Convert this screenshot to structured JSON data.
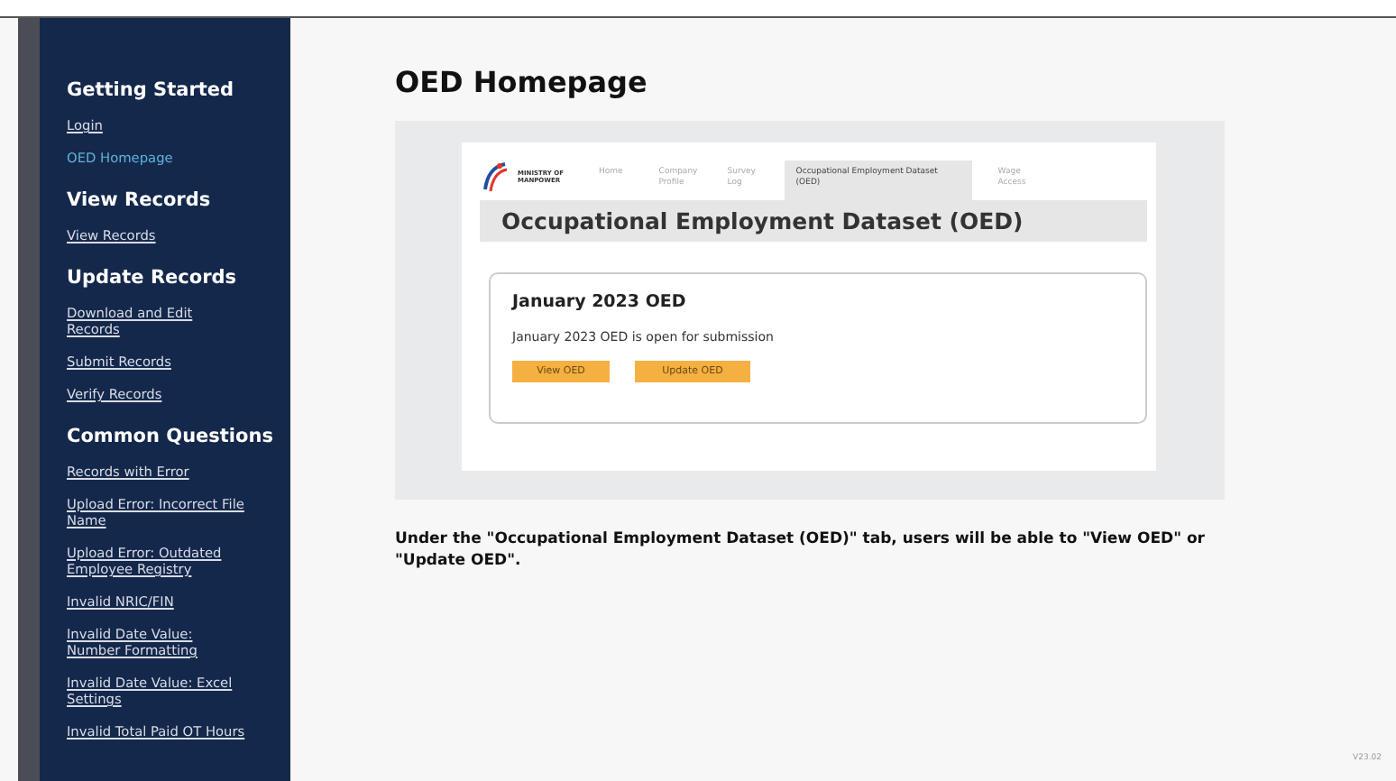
{
  "sidebar": {
    "sections": [
      {
        "heading": "Getting Started",
        "links": [
          {
            "label": "Login",
            "selected": false
          },
          {
            "label": "OED Homepage",
            "selected": true
          }
        ]
      },
      {
        "heading": "View Records",
        "links": [
          {
            "label": "View Records",
            "selected": false
          }
        ]
      },
      {
        "heading": "Update Records",
        "links": [
          {
            "label": "Download and Edit Records",
            "selected": false
          },
          {
            "label": "Submit Records",
            "selected": false
          },
          {
            "label": "Verify Records",
            "selected": false
          }
        ]
      },
      {
        "heading": "Common Questions",
        "links": [
          {
            "label": "Records with Error",
            "selected": false
          },
          {
            "label": "Upload Error: Incorrect File Name",
            "selected": false
          },
          {
            "label": "Upload Error: Outdated Employee Registry",
            "selected": false
          },
          {
            "label": "Invalid NRIC/FIN",
            "selected": false
          },
          {
            "label": "Invalid Date Value: Number Formatting",
            "selected": false
          },
          {
            "label": "Invalid Date Value: Excel Settings",
            "selected": false
          },
          {
            "label": "Invalid Total Paid OT Hours",
            "selected": false
          }
        ]
      }
    ]
  },
  "page_title": "OED Homepage",
  "screenshot": {
    "logo_text": "MINISTRY OF MANPOWER",
    "tabs": [
      {
        "label": "Home",
        "selected": false
      },
      {
        "label": "Company Profile",
        "selected": false
      },
      {
        "label": "Survey Log",
        "selected": false
      },
      {
        "label": "Occupational Employment Dataset (OED)",
        "selected": true
      },
      {
        "label": "Wage Access",
        "selected": false
      }
    ],
    "heading": "Occupational Employment Dataset (OED)",
    "card": {
      "title": "January 2023 OED",
      "message": "January 2023 OED is open for submission",
      "buttons": [
        "View OED",
        "Update OED"
      ]
    }
  },
  "caption": "Under the \"Occupational Employment Dataset (OED)\" tab, users will be able to \"View OED\" or  \"Update OED\".",
  "version": "V23.02"
}
